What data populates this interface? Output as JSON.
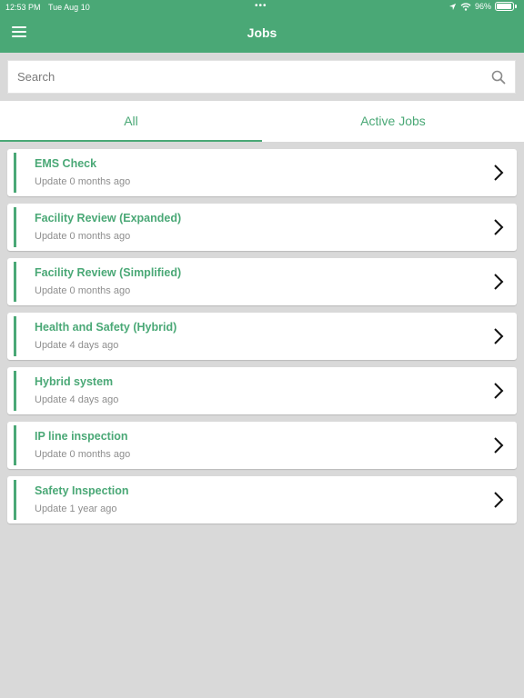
{
  "status_bar": {
    "time": "12:53 PM",
    "date": "Tue Aug 10",
    "dots": "•••",
    "battery": "96%",
    "battery_level": 0.96
  },
  "header": {
    "title": "Jobs",
    "background": "#4aa876"
  },
  "search": {
    "placeholder": "Search",
    "value": ""
  },
  "tabs": [
    {
      "label": "All",
      "active": true
    },
    {
      "label": "Active Jobs",
      "active": false
    }
  ],
  "jobs": [
    {
      "title": "EMS Check",
      "updated": "Update 0 months ago"
    },
    {
      "title": "Facility Review (Expanded)",
      "updated": "Update 0 months ago"
    },
    {
      "title": "Facility Review (Simplified)",
      "updated": "Update 0 months ago"
    },
    {
      "title": "Health and Safety (Hybrid)",
      "updated": "Update 4 days ago"
    },
    {
      "title": "Hybrid system",
      "updated": "Update 4 days ago"
    },
    {
      "title": "IP line inspection",
      "updated": "Update 0 months ago"
    },
    {
      "title": "Safety Inspection",
      "updated": "Update 1 year ago"
    }
  ],
  "colors": {
    "accent": "#4aa876",
    "page_background": "#d9d9d9",
    "subtitle_text": "#8e8e8e"
  },
  "icons": {
    "menu": "hamburger-icon",
    "search": "search-icon",
    "job_row": "chevron-right-icon",
    "location": "location-arrow-icon",
    "wifi": "wifi-icon",
    "battery": "battery-icon"
  }
}
